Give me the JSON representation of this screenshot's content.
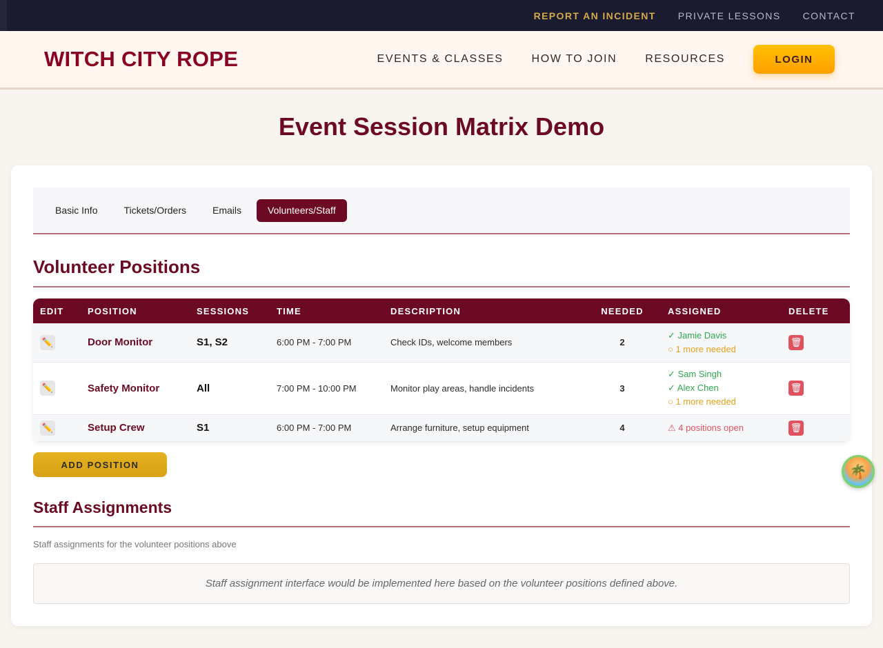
{
  "utility_nav": {
    "report": "REPORT AN INCIDENT",
    "lessons": "PRIVATE LESSONS",
    "contact": "CONTACT"
  },
  "header": {
    "brand": "WITCH CITY ROPE",
    "nav": [
      "EVENTS & CLASSES",
      "HOW TO JOIN",
      "RESOURCES"
    ],
    "login": "LOGIN"
  },
  "page_title": "Event Session Matrix Demo",
  "tabs": [
    {
      "label": "Basic Info",
      "active": false
    },
    {
      "label": "Tickets/Orders",
      "active": false
    },
    {
      "label": "Emails",
      "active": false
    },
    {
      "label": "Volunteers/Staff",
      "active": true
    }
  ],
  "volunteer_section": {
    "title": "Volunteer Positions",
    "columns": [
      "EDIT",
      "POSITION",
      "SESSIONS",
      "TIME",
      "DESCRIPTION",
      "NEEDED",
      "ASSIGNED",
      "DELETE"
    ],
    "rows": [
      {
        "position": "Door Monitor",
        "sessions": "S1, S2",
        "time": "6:00 PM - 7:00 PM",
        "description": "Check IDs, welcome members",
        "needed": "2",
        "assigned": [
          "✓ Jamie Davis"
        ],
        "status": "○ 1 more needed"
      },
      {
        "position": "Safety Monitor",
        "sessions": "All",
        "time": "7:00 PM - 10:00 PM",
        "description": "Monitor play areas, handle incidents",
        "needed": "3",
        "assigned": [
          "✓ Sam Singh",
          "✓ Alex Chen"
        ],
        "status": "○ 1 more needed"
      },
      {
        "position": "Setup Crew",
        "sessions": "S1",
        "time": "6:00 PM - 7:00 PM",
        "description": "Arrange furniture, setup equipment",
        "needed": "4",
        "assigned": [],
        "status": "⚠ 4 positions open"
      }
    ],
    "add_button": "ADD POSITION"
  },
  "staff_section": {
    "title": "Staff Assignments",
    "subtitle": "Staff assignments for the volunteer positions above",
    "placeholder": "Staff assignment interface would be implemented here based on the volunteer positions defined above."
  },
  "icons": {
    "edit": "pencil-icon",
    "delete": "trash-icon",
    "orb": "island-icon"
  },
  "colors": {
    "brand": "#880124",
    "accent_dark": "#6b0a22",
    "login_gold": "#ffb000",
    "success": "#2fa84f",
    "warning": "#e6a21a",
    "danger": "#e05260"
  }
}
